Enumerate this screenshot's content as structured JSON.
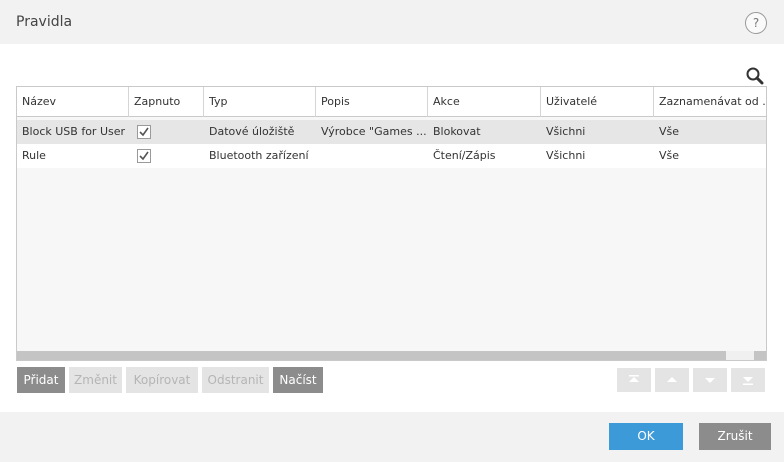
{
  "window": {
    "title": "Pravidla",
    "help": "?"
  },
  "table": {
    "columns": [
      "Název",
      "Zapnuto",
      "Typ",
      "Popis",
      "Akce",
      "Uživatelé",
      "Zaznamenávat od ..."
    ],
    "rows": [
      {
        "name": "Block USB for User",
        "enabled": true,
        "type": "Datové úložiště",
        "description": "Výrobce \"Games ...",
        "action": "Blokovat",
        "users": "Všichni",
        "log": "Vše"
      },
      {
        "name": "Rule",
        "enabled": true,
        "type": "Bluetooth zařízení",
        "description": "",
        "action": "Čtení/Zápis",
        "users": "Všichni",
        "log": "Vše"
      }
    ]
  },
  "toolbar": {
    "add": "Přidat",
    "edit": "Změnit",
    "copy": "Kopírovat",
    "remove": "Odstranit",
    "load": "Načíst"
  },
  "footer": {
    "ok": "OK",
    "cancel": "Zrušit"
  },
  "colors": {
    "accent": "#3d9ad9",
    "button_dark": "#8c8c8c",
    "selected_row": "#e6e6e6"
  }
}
